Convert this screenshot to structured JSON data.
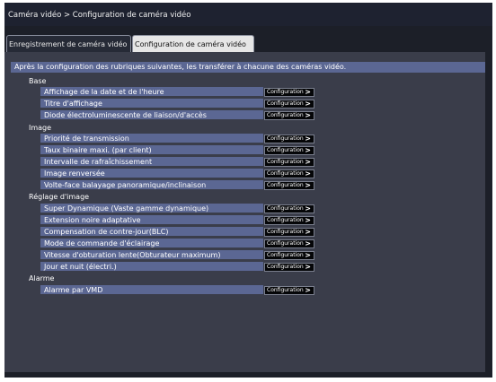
{
  "window": {
    "title": "Caméra vidéo > Configuration de caméra vidéo"
  },
  "tabs": [
    {
      "label": "Enregistrement de caméra vidéo",
      "active": false
    },
    {
      "label": "Configuration de caméra vidéo",
      "active": true
    }
  ],
  "intro": "Après la configuration des rubriques suivantes, les transférer à chacune des caméras vidéo.",
  "button_label": "Configuration",
  "button_arrow": ">",
  "sections": {
    "base": {
      "label": "Base",
      "items": [
        "Affichage de la date et de l'heure",
        "Titre d'affichage",
        "Diode électroluminescente de liaison/d'accès"
      ]
    },
    "image": {
      "label": "Image",
      "items": [
        "Priorité de transmission",
        "Taux binaire maxi. (par client)",
        "Intervalle de rafraîchissement",
        "Image renversée",
        "Volte-face balayage panoramique/inclinaison"
      ]
    },
    "reglage": {
      "label": "Réglage d'image",
      "items": [
        "Super Dynamique (Vaste gamme dynamique)",
        "Extension noire adaptative",
        "Compensation de contre-jour(BLC)",
        "Mode de commande d'éclairage",
        "Vitesse d'obturation lente(Obturateur maximum)",
        "Jour et nuit (électri.)"
      ]
    },
    "alarme": {
      "label": "Alarme",
      "items": [
        "Alarme par VMD"
      ]
    }
  },
  "colors": {
    "frame": "#1c1f28",
    "panel": "#3a3d4a",
    "row": "#5b6793",
    "button": "#050608",
    "active_tab": "#e6e6e6"
  }
}
